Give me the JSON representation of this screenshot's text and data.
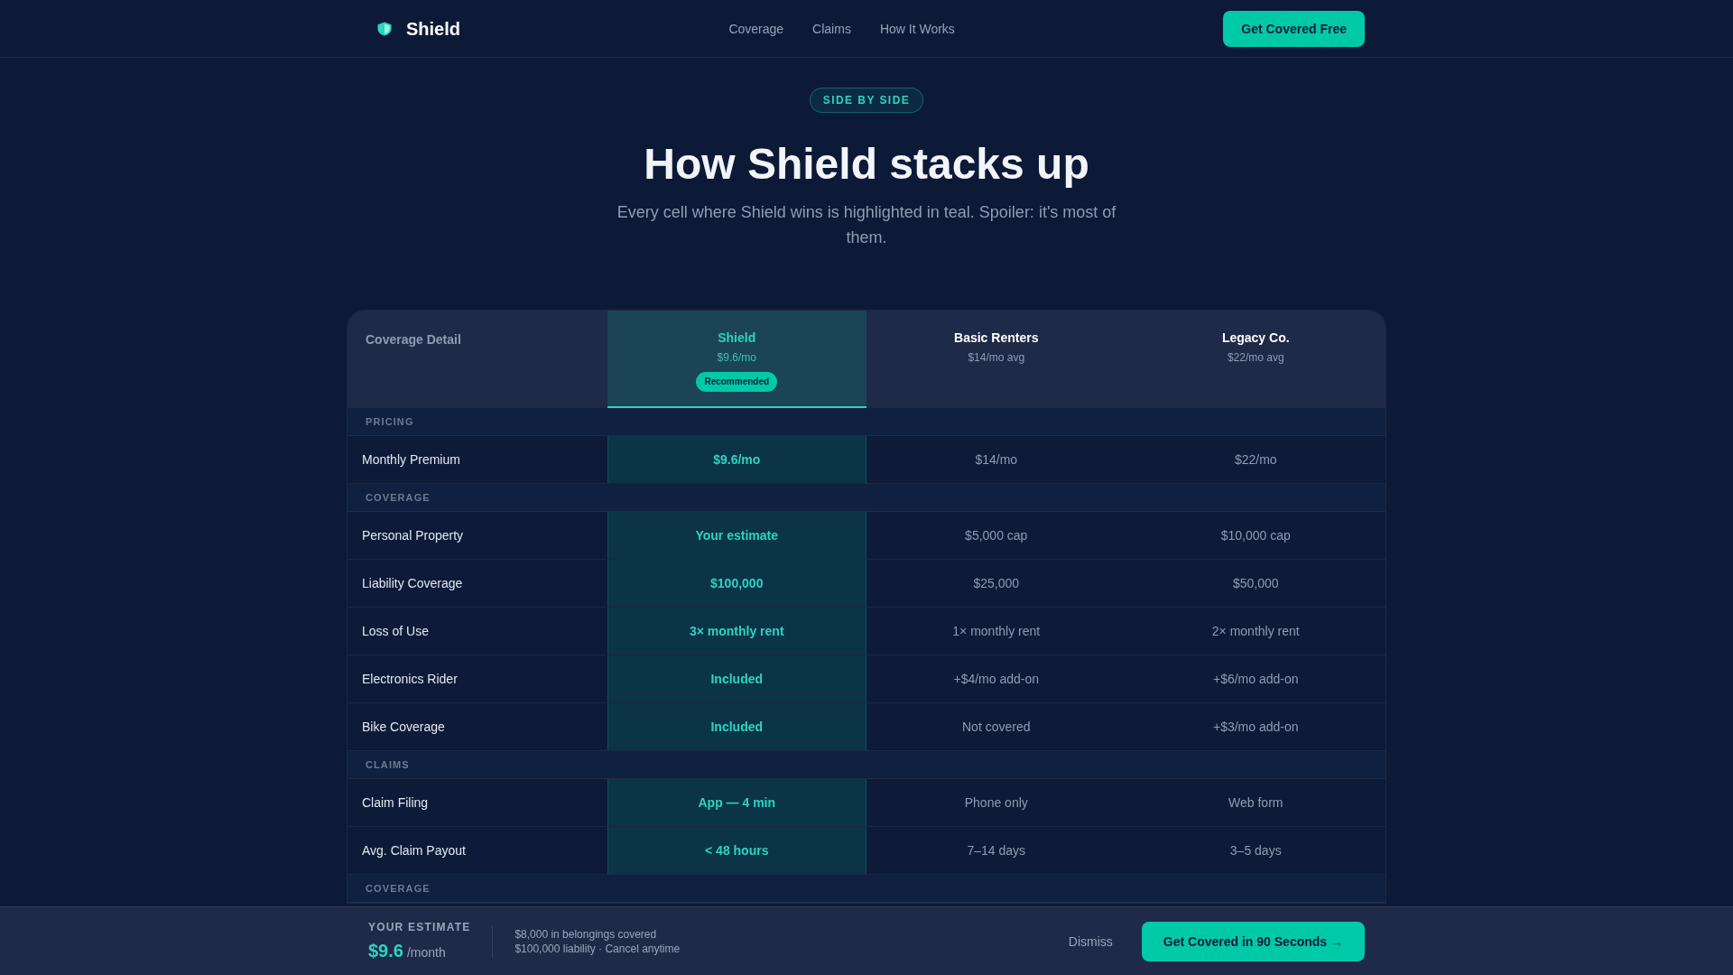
{
  "nav": {
    "brand": "Shield",
    "links": [
      "Coverage",
      "Claims",
      "How It Works"
    ],
    "cta": "Get Covered Free"
  },
  "hero": {
    "badge": "SIDE BY SIDE",
    "title": "How Shield stacks up",
    "subtitle": "Every cell where Shield wins is highlighted in teal. Spoiler: it's most of them."
  },
  "table": {
    "label_column": "Coverage Detail",
    "plans": [
      {
        "name": "Shield",
        "price": "$9.6/mo",
        "badge": "Recommended",
        "highlighted": true
      },
      {
        "name": "Basic Renters",
        "price": "$14/mo avg",
        "highlighted": false
      },
      {
        "name": "Legacy Co.",
        "price": "$22/mo avg",
        "highlighted": false
      }
    ],
    "sections": [
      {
        "title": "PRICING",
        "rows": [
          {
            "label": "Monthly Premium",
            "values": [
              "$9.6/mo",
              "$14/mo",
              "$22/mo"
            ]
          }
        ]
      },
      {
        "title": "COVERAGE",
        "rows": [
          {
            "label": "Personal Property",
            "values": [
              "Your estimate",
              "$5,000 cap",
              "$10,000 cap"
            ]
          },
          {
            "label": "Liability Coverage",
            "values": [
              "$100,000",
              "$25,000",
              "$50,000"
            ]
          },
          {
            "label": "Loss of Use",
            "values": [
              "3× monthly rent",
              "1× monthly rent",
              "2× monthly rent"
            ]
          },
          {
            "label": "Electronics Rider",
            "values": [
              "Included",
              "+$4/mo add-on",
              "+$6/mo add-on"
            ]
          },
          {
            "label": "Bike Coverage",
            "values": [
              "Included",
              "Not covered",
              "+$3/mo add-on"
            ]
          }
        ]
      },
      {
        "title": "CLAIMS",
        "rows": [
          {
            "label": "Claim Filing",
            "values": [
              "App — 4 min",
              "Phone only",
              "Web form"
            ]
          },
          {
            "label": "Avg. Claim Payout",
            "values": [
              "< 48 hours",
              "7–14 days",
              "3–5 days"
            ]
          }
        ]
      },
      {
        "title": "COVERAGE"
      }
    ]
  },
  "estimate_bar": {
    "label": "YOUR ESTIMATE",
    "amount": "$9.6",
    "unit": "/month",
    "details": [
      "$8,000 in belongings covered",
      "$100,000 liability · Cancel anytime"
    ],
    "dismiss": "Dismiss",
    "cta": "Get Covered in 90 Seconds →"
  }
}
